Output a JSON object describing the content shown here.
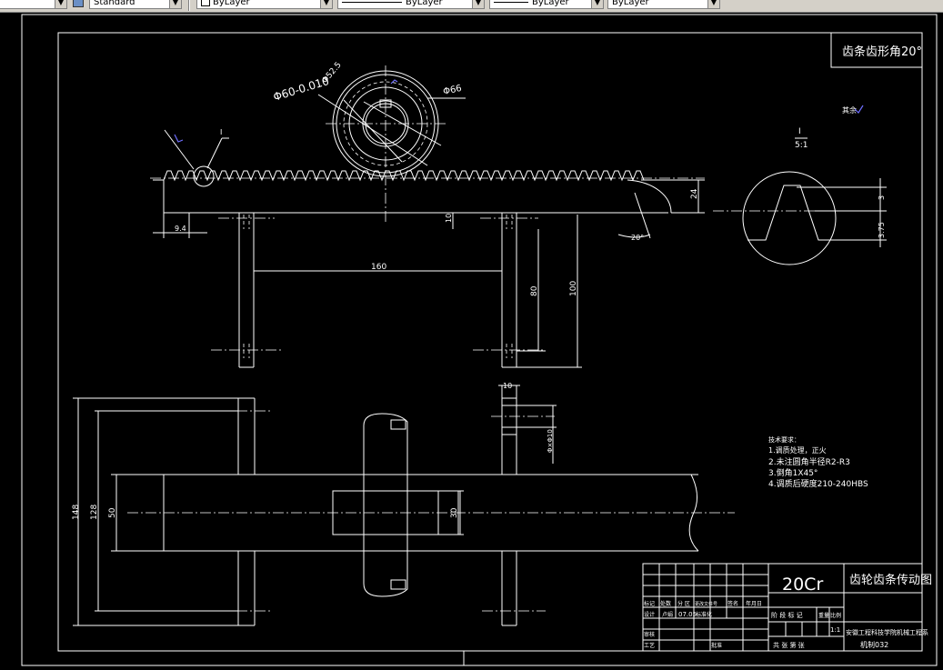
{
  "toolbar": {
    "text_style": "Standard",
    "layer": "ByLayer",
    "linetype": "ByLayer",
    "lineweight": "ByLayer",
    "plot_style": "ByLayer"
  },
  "drawing": {
    "tooth_profile_label": "齿条齿形角20°",
    "detail_label": "I",
    "detail_scale": "5:1",
    "roughness_label": "其余",
    "gear_labels": {
      "d_bore": "Φ60-0.010",
      "d_pitch": "Φ52.5",
      "d_tip": "Φ66"
    },
    "rack_labels": {
      "detail_mark": "I",
      "h24": "24",
      "left9_4": "9.4",
      "angle20": "20°",
      "dim160": "160",
      "dim10_top": "10",
      "dim80": "80",
      "dim100": "100",
      "detail_h3": "3",
      "detail_h3_75": "3.75"
    },
    "bottom_labels": {
      "dim148": "148",
      "dim128": "128",
      "dim50": "50",
      "dim30": "30",
      "dim10": "10",
      "dim_phi10": "Φ×Φ10"
    },
    "notes": {
      "title": "技术要求：",
      "items": [
        "1.调质处理，正火",
        "2.未注圆角半径R2-R3",
        "3.倒角1X45°",
        "4.调质后硬度210-240HBS"
      ]
    },
    "title_block": {
      "material": "20Cr",
      "drawing_name": "齿轮齿条传动图",
      "scale": "1:1",
      "school": "安徽工程科技学院机械工程系",
      "drawing_no": "机制032",
      "sheets": "共 张 第 张",
      "stage_header": "阶 段 标 记",
      "weight_header": "重量",
      "scale_header": "比例",
      "row1": [
        "标记",
        "处数",
        "分 区",
        "更改文件号",
        "签名",
        "年月日"
      ],
      "row2": [
        "设计",
        "卢娟",
        "07.05",
        "标准化"
      ],
      "row3": [
        "审核"
      ],
      "row4": [
        "工艺",
        "批准"
      ]
    }
  }
}
